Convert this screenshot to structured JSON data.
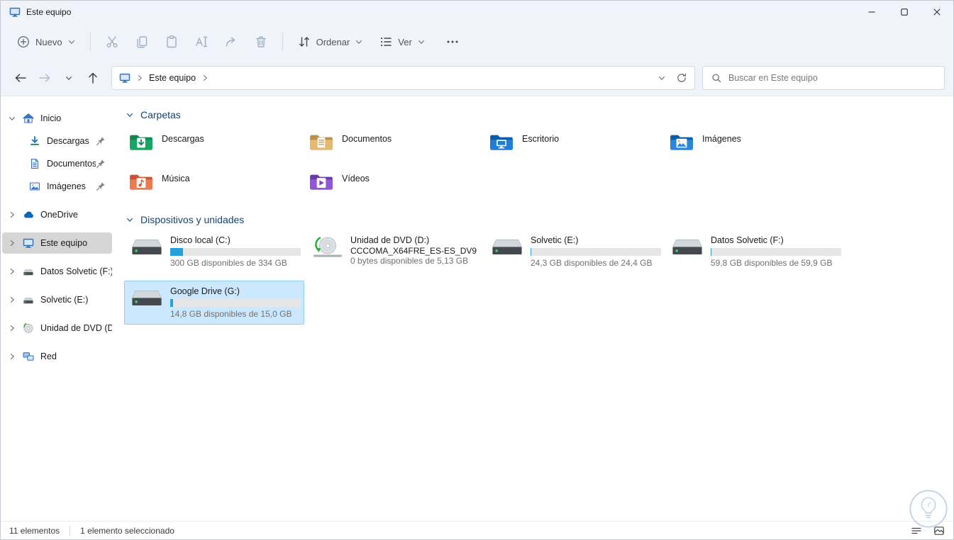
{
  "window": {
    "title": "Este equipo"
  },
  "toolbar": {
    "new_label": "Nuevo",
    "sort_label": "Ordenar",
    "view_label": "Ver"
  },
  "navbar": {
    "breadcrumb_root": "Este equipo",
    "search_placeholder": "Buscar en Este equipo"
  },
  "sidebar": {
    "items": [
      {
        "label": "Inicio"
      },
      {
        "label": "Descargas",
        "pinned": true
      },
      {
        "label": "Documentos",
        "pinned": true
      },
      {
        "label": "Imágenes",
        "pinned": true
      },
      {
        "label": "OneDrive"
      },
      {
        "label": "Este equipo",
        "selected": true
      },
      {
        "label": "Datos Solvetic (F:)"
      },
      {
        "label": "Solvetic (E:)"
      },
      {
        "label": "Unidad de DVD (D:)"
      },
      {
        "label": "Red"
      }
    ]
  },
  "main": {
    "carpetas": {
      "title": "Carpetas",
      "items": [
        {
          "name": "Descargas"
        },
        {
          "name": "Documentos"
        },
        {
          "name": "Escritorio"
        },
        {
          "name": "Imágenes"
        },
        {
          "name": "Música"
        },
        {
          "name": "Vídeos"
        }
      ]
    },
    "dispositivos": {
      "title": "Dispositivos y unidades",
      "drives": [
        {
          "name": "Disco local (C:)",
          "detail": "300 GB disponibles de 334 GB",
          "fill_percent": 10
        },
        {
          "name": "Unidad de DVD (D:)",
          "subtitle": "CCCOMA_X64FRE_ES-ES_DV9",
          "detail": "0 bytes disponibles de 5,13 GB"
        },
        {
          "name": "Solvetic (E:)",
          "detail": "24,3 GB disponibles de 24,4 GB",
          "fill_percent": 0.5
        },
        {
          "name": "Datos Solvetic (F:)",
          "detail": "59,8 GB disponibles de 59,9 GB",
          "fill_percent": 0.5
        },
        {
          "name": "Google Drive (G:)",
          "detail": "14,8 GB disponibles de 15,0 GB",
          "fill_percent": 2,
          "selected": true
        }
      ]
    }
  },
  "statusbar": {
    "items_count": "11 elementos",
    "selection_count": "1 elemento seleccionado"
  },
  "colors": {
    "selection_fill": "#cce8ff",
    "selection_border": "#8ecdf3",
    "sidebar_selected": "#d5d5d5",
    "bar_fill": "#26a0da",
    "bar_track": "#e6e6e6",
    "accent": "#0067c0"
  }
}
